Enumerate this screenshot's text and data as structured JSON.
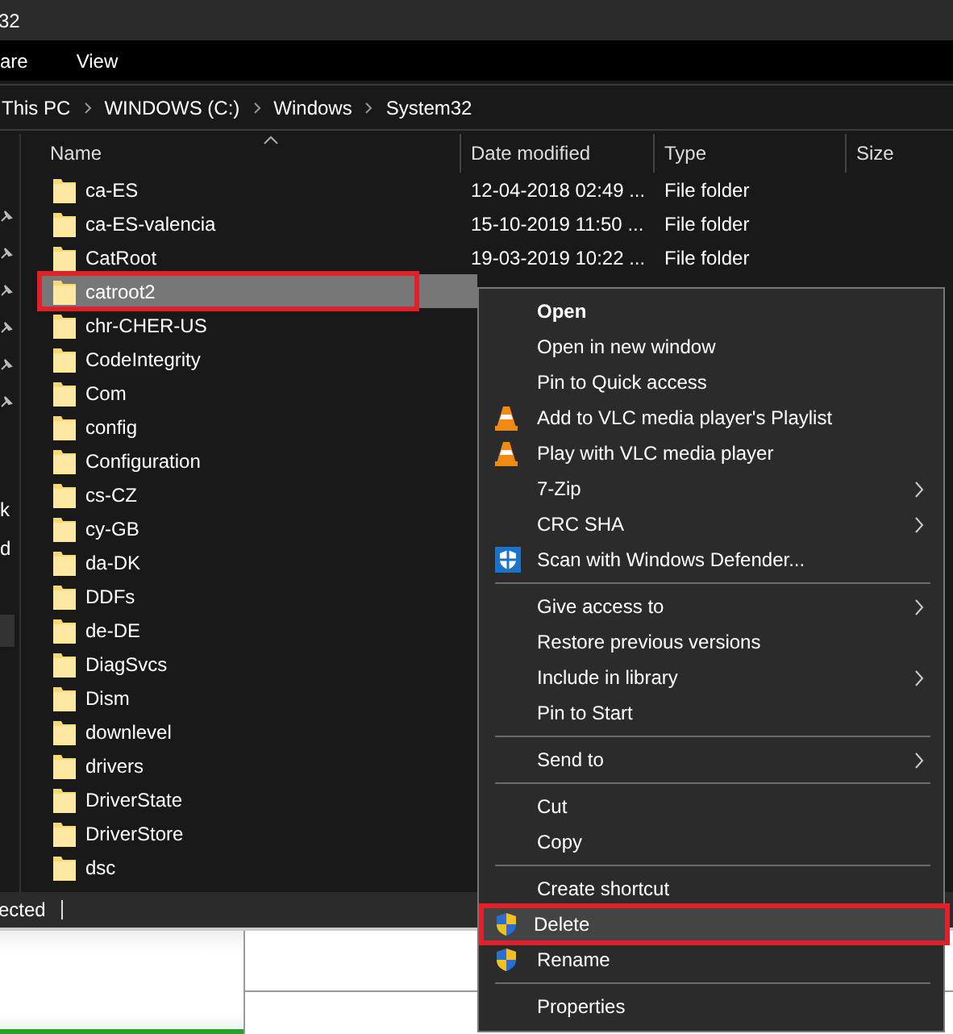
{
  "window": {
    "title": "32"
  },
  "ribbon_tabs": [
    {
      "label": "are",
      "selected": false
    },
    {
      "label": "View",
      "selected": false
    }
  ],
  "breadcrumb": [
    "This PC",
    "WINDOWS (C:)",
    "Windows",
    "System32"
  ],
  "nav": {
    "items": [
      {
        "label": "k",
        "selected": false
      },
      {
        "label": "d",
        "selected": false
      }
    ]
  },
  "columns": [
    "Name",
    "Date modified",
    "Type",
    "Size"
  ],
  "rows": [
    {
      "name": "ca-ES",
      "date": "12-04-2018 02:49 ...",
      "type": "File folder",
      "selected": false,
      "marked": false
    },
    {
      "name": "ca-ES-valencia",
      "date": "15-10-2019 11:50 ...",
      "type": "File folder",
      "selected": false,
      "marked": false
    },
    {
      "name": "CatRoot",
      "date": "19-03-2019 10:22 ...",
      "type": "File folder",
      "selected": false,
      "marked": false
    },
    {
      "name": "catroot2",
      "selected": true,
      "marked": true
    },
    {
      "name": "chr-CHER-US",
      "selected": false,
      "marked": false
    },
    {
      "name": "CodeIntegrity",
      "selected": false,
      "marked": false
    },
    {
      "name": "Com",
      "selected": false,
      "marked": false
    },
    {
      "name": "config",
      "selected": false,
      "marked": false
    },
    {
      "name": "Configuration",
      "selected": false,
      "marked": false
    },
    {
      "name": "cs-CZ",
      "selected": false,
      "marked": false
    },
    {
      "name": "cy-GB",
      "selected": false,
      "marked": false
    },
    {
      "name": "da-DK",
      "selected": false,
      "marked": false
    },
    {
      "name": "DDFs",
      "selected": false,
      "marked": false
    },
    {
      "name": "de-DE",
      "selected": false,
      "marked": false
    },
    {
      "name": "DiagSvcs",
      "selected": false,
      "marked": false
    },
    {
      "name": "Dism",
      "selected": false,
      "marked": false
    },
    {
      "name": "downlevel",
      "selected": false,
      "marked": false
    },
    {
      "name": "drivers",
      "selected": false,
      "marked": false
    },
    {
      "name": "DriverState",
      "selected": false,
      "marked": false
    },
    {
      "name": "DriverStore",
      "selected": false,
      "marked": false
    },
    {
      "name": "dsc",
      "selected": false,
      "marked": false
    }
  ],
  "status_bar": {
    "text": "ected"
  },
  "context_menu": [
    {
      "kind": "item",
      "label": "Open",
      "bold": true
    },
    {
      "kind": "item",
      "label": "Open in new window"
    },
    {
      "kind": "item",
      "label": "Pin to Quick access"
    },
    {
      "kind": "cone-item",
      "label": "Add to VLC media player's Playlist"
    },
    {
      "kind": "cone-item",
      "label": "Play with VLC media player"
    },
    {
      "kind": "item",
      "label": "7-Zip",
      "submenu": true
    },
    {
      "kind": "item",
      "label": "CRC SHA",
      "submenu": true
    },
    {
      "kind": "defender-item",
      "label": "Scan with Windows Defender..."
    },
    {
      "kind": "separator"
    },
    {
      "kind": "item",
      "label": "Give access to",
      "submenu": true
    },
    {
      "kind": "item",
      "label": "Restore previous versions"
    },
    {
      "kind": "item",
      "label": "Include in library",
      "submenu": true
    },
    {
      "kind": "item",
      "label": "Pin to Start"
    },
    {
      "kind": "separator"
    },
    {
      "kind": "item",
      "label": "Send to",
      "submenu": true
    },
    {
      "kind": "separator"
    },
    {
      "kind": "item",
      "label": "Cut"
    },
    {
      "kind": "item",
      "label": "Copy"
    },
    {
      "kind": "separator"
    },
    {
      "kind": "item",
      "label": "Create shortcut"
    },
    {
      "kind": "shield-item",
      "label": "Delete",
      "selected": true,
      "marked": true
    },
    {
      "kind": "shield-item",
      "label": "Rename"
    },
    {
      "kind": "separator"
    },
    {
      "kind": "item",
      "label": "Properties"
    }
  ]
}
